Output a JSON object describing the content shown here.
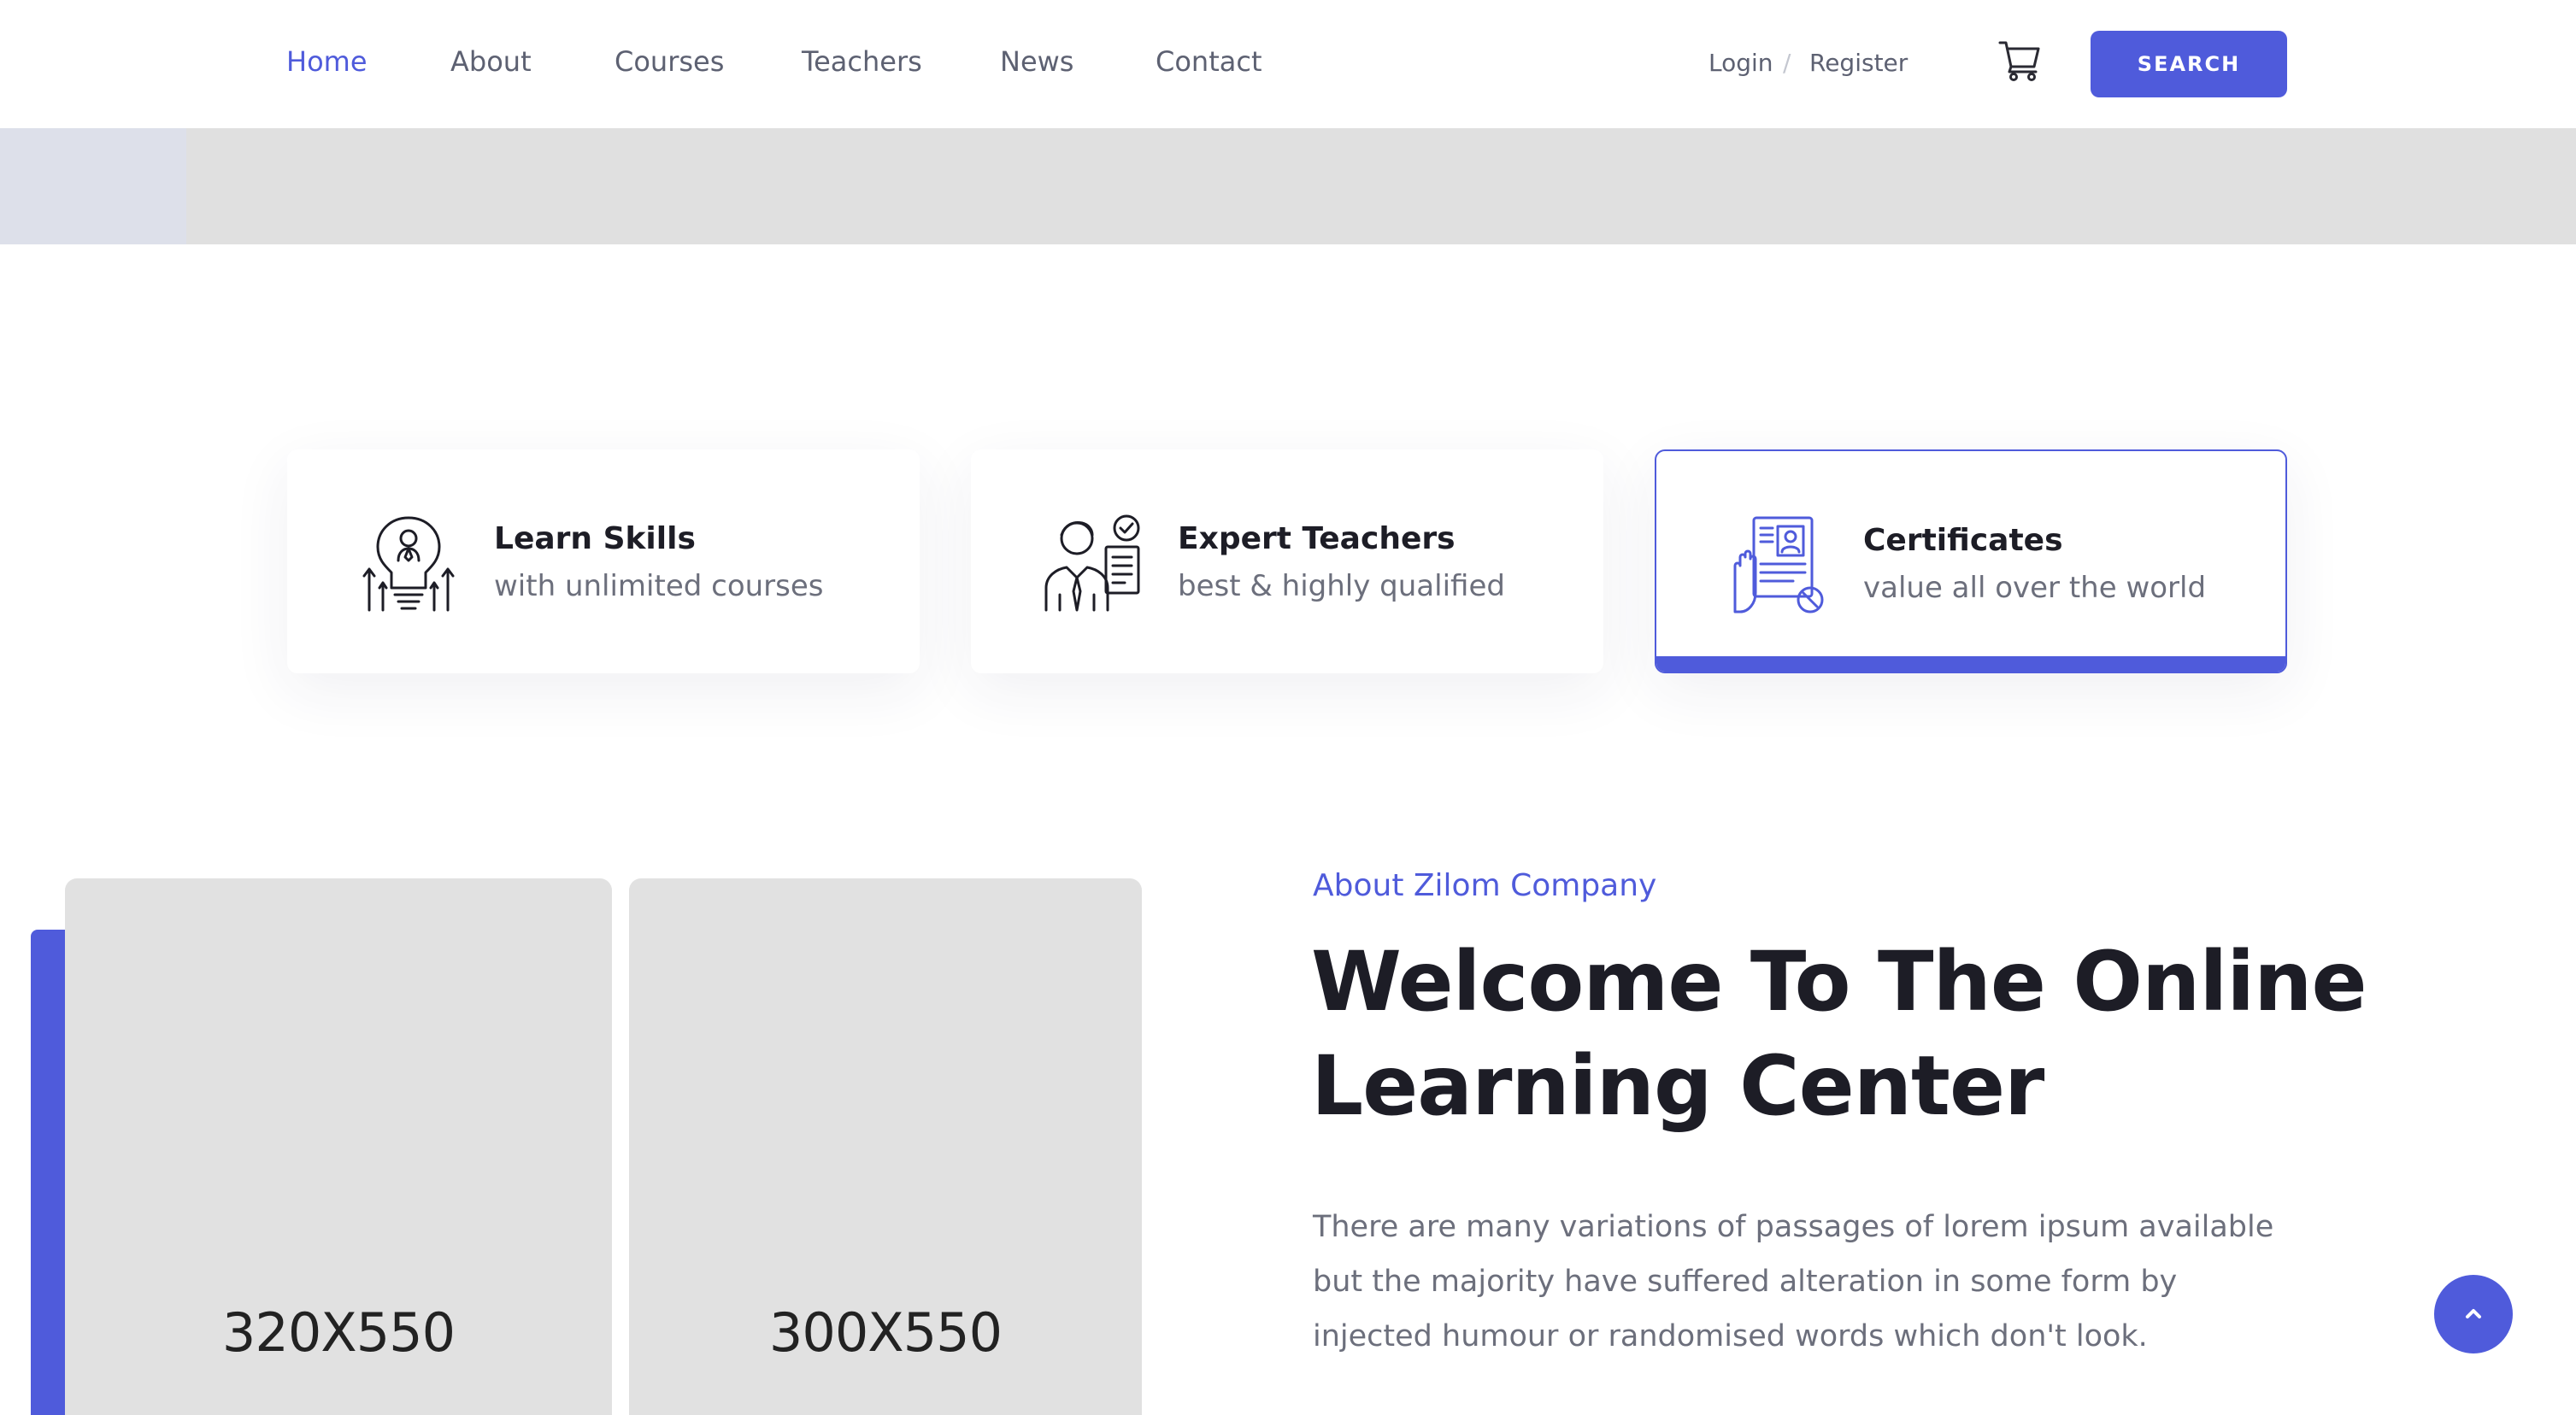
{
  "nav": {
    "items": [
      {
        "label": "Home",
        "active": true
      },
      {
        "label": "About",
        "active": false
      },
      {
        "label": "Courses",
        "active": false
      },
      {
        "label": "Teachers",
        "active": false
      },
      {
        "label": "News",
        "active": false
      },
      {
        "label": "Contact",
        "active": false
      }
    ],
    "login_label": "Login",
    "separator": "/",
    "register_label": "Register",
    "cart_icon": "cart-icon",
    "search_label": "SEARCH"
  },
  "features": [
    {
      "icon": "lightbulb-icon",
      "title": "Learn Skills",
      "subtitle": "with unlimited courses",
      "selected": false
    },
    {
      "icon": "teacher-icon",
      "title": "Expert Teachers",
      "subtitle": "best & highly qualified",
      "selected": false
    },
    {
      "icon": "certificate-icon",
      "title": "Certificates",
      "subtitle": "value all over the world",
      "selected": true
    }
  ],
  "about": {
    "images": [
      {
        "label": "320X550"
      },
      {
        "label": "300X550"
      }
    ],
    "kicker": "About Zilom Company",
    "title": "Welcome To The Online Learning Center",
    "body": "There are many variations of passages of lorem ipsum available but the majority have suffered alteration in some form by injected humour or randomised words which don't look."
  },
  "scroll_top_icon": "chevron-up-icon",
  "colors": {
    "accent": "#4f5bdb",
    "heading": "#1d1d26",
    "muted": "#6c6f7c",
    "placeholder": "#e1e1e1"
  }
}
